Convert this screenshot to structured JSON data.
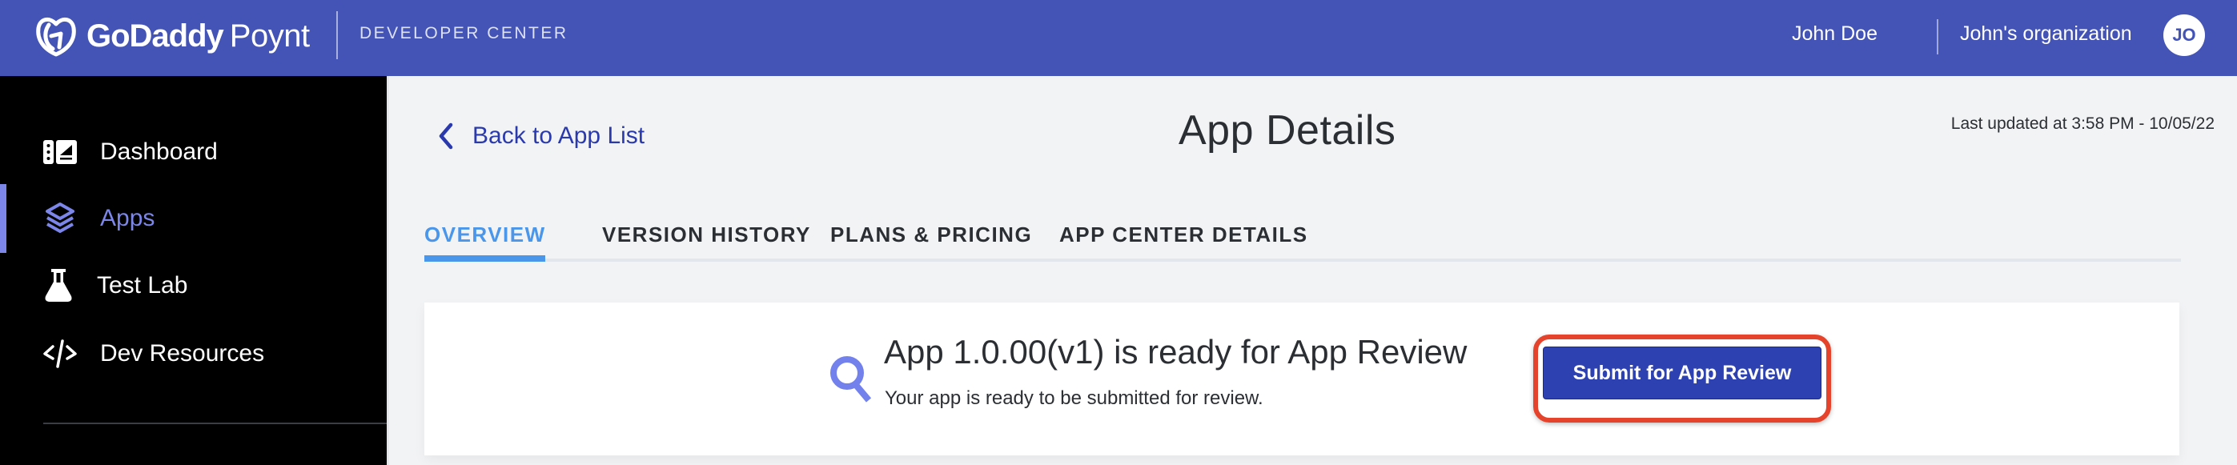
{
  "header": {
    "brand_primary": "GoDaddy",
    "brand_secondary": "Poynt",
    "section_label": "DEVELOPER CENTER",
    "user_name": "John Doe",
    "organization": "John's organization",
    "avatar_initials": "JO",
    "brand_color": "#4353b6"
  },
  "sidebar": {
    "active_color": "#7b86e8",
    "items": [
      {
        "label": "Dashboard",
        "icon": "dashboard-icon",
        "active": false
      },
      {
        "label": "Apps",
        "icon": "layers-icon",
        "active": true
      },
      {
        "label": "Test Lab",
        "icon": "flask-icon",
        "active": false
      },
      {
        "label": "Dev Resources",
        "icon": "code-icon",
        "active": false
      }
    ]
  },
  "main": {
    "back_link": "Back to App List",
    "title": "App Details",
    "last_updated": "Last updated at 3:58 PM - 10/05/22",
    "tabs": [
      {
        "label": "OVERVIEW",
        "active": true
      },
      {
        "label": "VERSION HISTORY",
        "active": false
      },
      {
        "label": "PLANS & PRICING",
        "active": false
      },
      {
        "label": "APP CENTER DETAILS",
        "active": false
      }
    ],
    "review_card": {
      "icon": "search-icon",
      "title": "App 1.0.00(v1) is ready for App Review",
      "subtitle": "Your app is ready to be submitted for review.",
      "button_label": "Submit for App Review",
      "highlight_color": "#e5432b"
    }
  }
}
